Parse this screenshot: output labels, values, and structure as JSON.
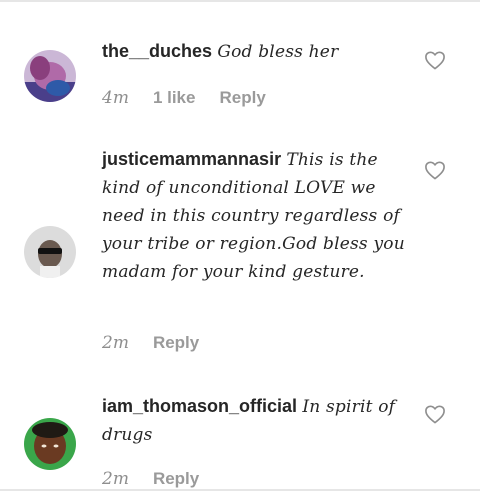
{
  "comments": [
    {
      "username": "the__duches",
      "text": "God bless her",
      "time": "4m",
      "likes": "1 like",
      "reply": "Reply",
      "avatar": "avatar-photo"
    },
    {
      "username": "justicemammannasir",
      "text": "This is the kind of unconditional LOVE we need in this country regardless of your tribe or region.God bless you madam for your kind gesture.",
      "time": "2m",
      "reply": "Reply",
      "avatar": "avatar-photo"
    },
    {
      "username": "iam_thomason_official",
      "text": "In spirit of drugs",
      "time": "2m",
      "reply": "Reply",
      "avatar": "avatar-photo"
    }
  ],
  "icons": {
    "like": "heart-outline-icon"
  },
  "colors": {
    "text": "#262626",
    "meta": "#8e8e8e",
    "icon": "#8e8e8e",
    "background": "#ffffff"
  }
}
